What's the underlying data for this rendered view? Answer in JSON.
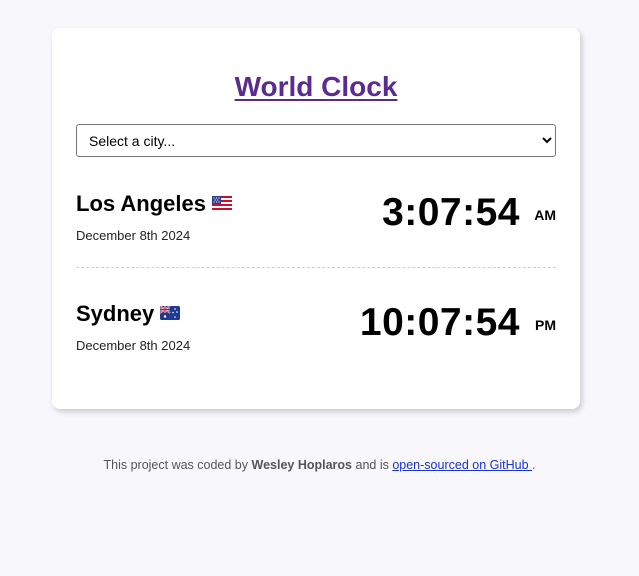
{
  "header": {
    "title": "World Clock"
  },
  "city_select": {
    "selected": "Select a city..."
  },
  "cities": [
    {
      "name": "Los Angeles",
      "flag_icon": "us-flag-icon",
      "date": "December 8th 2024",
      "time": "3:07:54",
      "period": "AM"
    },
    {
      "name": "Sydney",
      "flag_icon": "au-flag-icon",
      "date": "December 8th 2024",
      "time": "10:07:54",
      "period": "PM"
    }
  ],
  "footer": {
    "prefix": "This project was coded by ",
    "author": "Wesley Hoplaros",
    "middle": " and is ",
    "link_text": "open-sourced on GitHub ",
    "suffix": "."
  },
  "colors": {
    "background": "#f8f7fc",
    "title": "#5b2b91",
    "link": "#1a33cc",
    "card": "#ffffff"
  }
}
